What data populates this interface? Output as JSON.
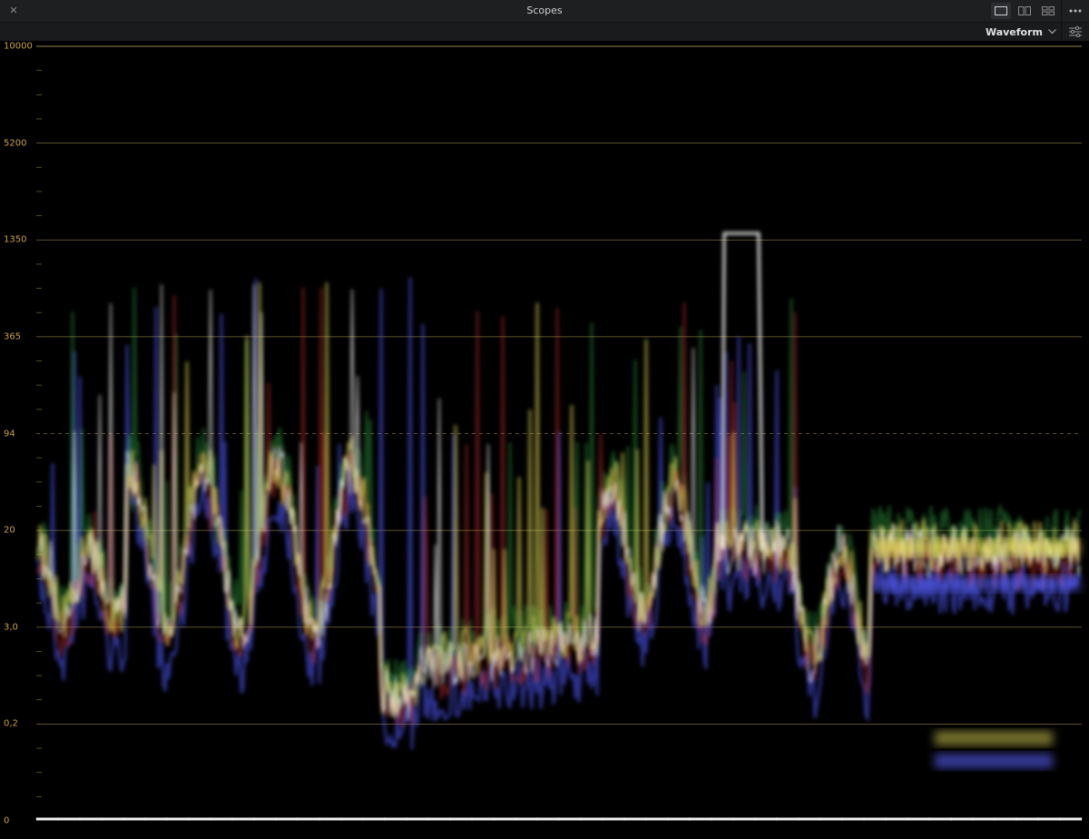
{
  "window": {
    "title": "Scopes",
    "close_icon": "close-icon",
    "layout_icons": [
      "single-view-icon",
      "dual-view-icon",
      "quad-view-icon"
    ],
    "menu_icon": "more-options-icon"
  },
  "toolbar": {
    "mode_label": "Waveform",
    "mode_icon": "chevron-down-icon",
    "settings_icon": "sliders-icon"
  },
  "scale": {
    "labels": [
      "10000",
      "5200",
      "1350",
      "365",
      "94",
      "20",
      "3,0",
      "0,2",
      "0"
    ],
    "dashed_label": "94",
    "line_color": "#7a6a3a",
    "label_color": "#c9a046"
  }
}
